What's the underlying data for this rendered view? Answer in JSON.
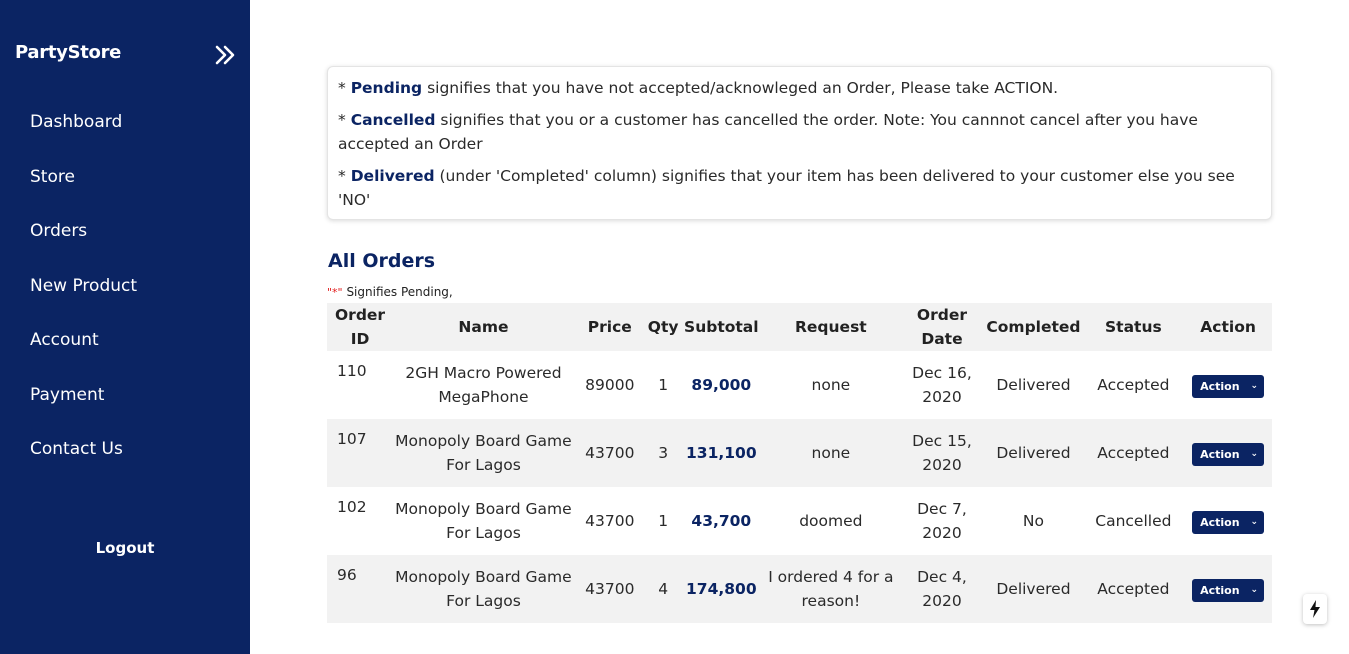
{
  "app": {
    "brand": "PartyStore",
    "logout": "Logout"
  },
  "sidebar": {
    "items": [
      {
        "label": "Dashboard"
      },
      {
        "label": "Store"
      },
      {
        "label": "Orders"
      },
      {
        "label": "New Product"
      },
      {
        "label": "Account"
      },
      {
        "label": "Payment"
      },
      {
        "label": "Contact Us"
      }
    ]
  },
  "notes": {
    "pending_prefix": "* ",
    "pending_term": "Pending",
    "pending_text": " signifies that you have not accepted/acknowleged an Order, Please take ACTION.",
    "cancelled_prefix": "* ",
    "cancelled_term": "Cancelled",
    "cancelled_text": " signifies that you or a customer has cancelled the order. Note: You cannnot cancel after you have accepted an Order",
    "delivered_prefix": "* ",
    "delivered_term": "Delivered",
    "delivered_text": " (under 'Completed' column) signifies that your item has been delivered to your customer else you see 'NO'"
  },
  "orders": {
    "title": "All Orders",
    "legend_star": "\"*\"",
    "legend_text": " Signifies Pending,",
    "headers": {
      "order_id": "Order ID",
      "name": "Name",
      "price": "Price",
      "qty": "Qty",
      "subtotal": "Subtotal",
      "request": "Request",
      "order_date": "Order Date",
      "completed": "Completed",
      "status": "Status",
      "action": "Action"
    },
    "action_label": "Action",
    "rows": [
      {
        "id": "110",
        "name": "2GH Macro Powered MegaPhone",
        "price": "89000",
        "qty": "1",
        "subtotal": "89,000",
        "request": "none",
        "date": "Dec 16, 2020",
        "completed": "Delivered",
        "status": "Accepted"
      },
      {
        "id": "107",
        "name": "Monopoly Board Game For Lagos",
        "price": "43700",
        "qty": "3",
        "subtotal": "131,100",
        "request": "none",
        "date": "Dec 15, 2020",
        "completed": "Delivered",
        "status": "Accepted"
      },
      {
        "id": "102",
        "name": "Monopoly Board Game For Lagos",
        "price": "43700",
        "qty": "1",
        "subtotal": "43,700",
        "request": "doomed",
        "date": "Dec 7, 2020",
        "completed": "No",
        "status": "Cancelled"
      },
      {
        "id": "96",
        "name": "Monopoly Board Game For Lagos",
        "price": "43700",
        "qty": "4",
        "subtotal": "174,800",
        "request": "I ordered 4 for a reason!",
        "date": "Dec 4, 2020",
        "completed": "Delivered",
        "status": "Accepted"
      }
    ]
  },
  "colors": {
    "sidebar_bg": "#0b2463",
    "accent": "#0b2463",
    "pending_star": "#e21d1d"
  },
  "icons": {
    "collapse": "double-chevron-right-icon",
    "bolt": "lightning-bolt-icon"
  }
}
